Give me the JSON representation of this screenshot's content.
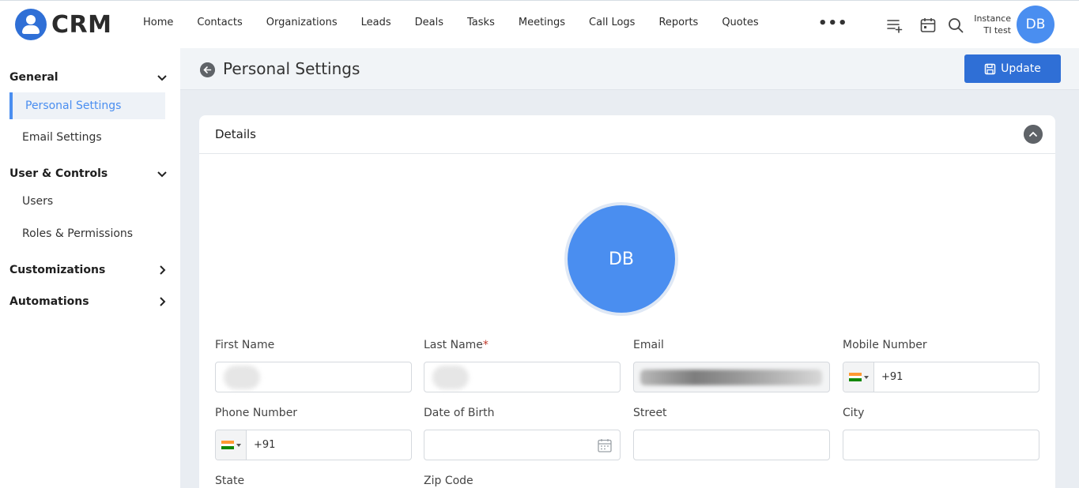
{
  "app": {
    "logo_text": "CRM"
  },
  "nav": {
    "items": [
      "Home",
      "Contacts",
      "Organizations",
      "Leads",
      "Deals",
      "Tasks",
      "Meetings",
      "Call Logs",
      "Reports",
      "Quotes"
    ],
    "more": "•••"
  },
  "user": {
    "instance_line1": "Instance",
    "instance_line2": "TI test",
    "initials": "DB"
  },
  "sidebar": {
    "general": "General",
    "personal_settings": "Personal Settings",
    "email_settings": "Email Settings",
    "user_controls": "User & Controls",
    "users": "Users",
    "roles_permissions": "Roles & Permissions",
    "customizations": "Customizations",
    "automations": "Automations"
  },
  "page": {
    "title": "Personal Settings",
    "update_label": "Update"
  },
  "details": {
    "title": "Details",
    "avatar_initials": "DB",
    "fields": {
      "first_name": {
        "label": "First Name",
        "value": ""
      },
      "last_name": {
        "label": "Last Name",
        "required_mark": "*",
        "value": ""
      },
      "email": {
        "label": "Email",
        "value": ""
      },
      "mobile": {
        "label": "Mobile Number",
        "code": "+91"
      },
      "phone": {
        "label": "Phone Number",
        "code": "+91"
      },
      "dob": {
        "label": "Date of Birth",
        "value": ""
      },
      "street": {
        "label": "Street",
        "value": ""
      },
      "city": {
        "label": "City",
        "value": ""
      },
      "state": {
        "label": "State"
      },
      "zip": {
        "label": "Zip Code"
      }
    }
  },
  "colors": {
    "accent": "#2f6fd6",
    "avatar": "#4a8ef0",
    "active_item": "#4a8ef0"
  }
}
